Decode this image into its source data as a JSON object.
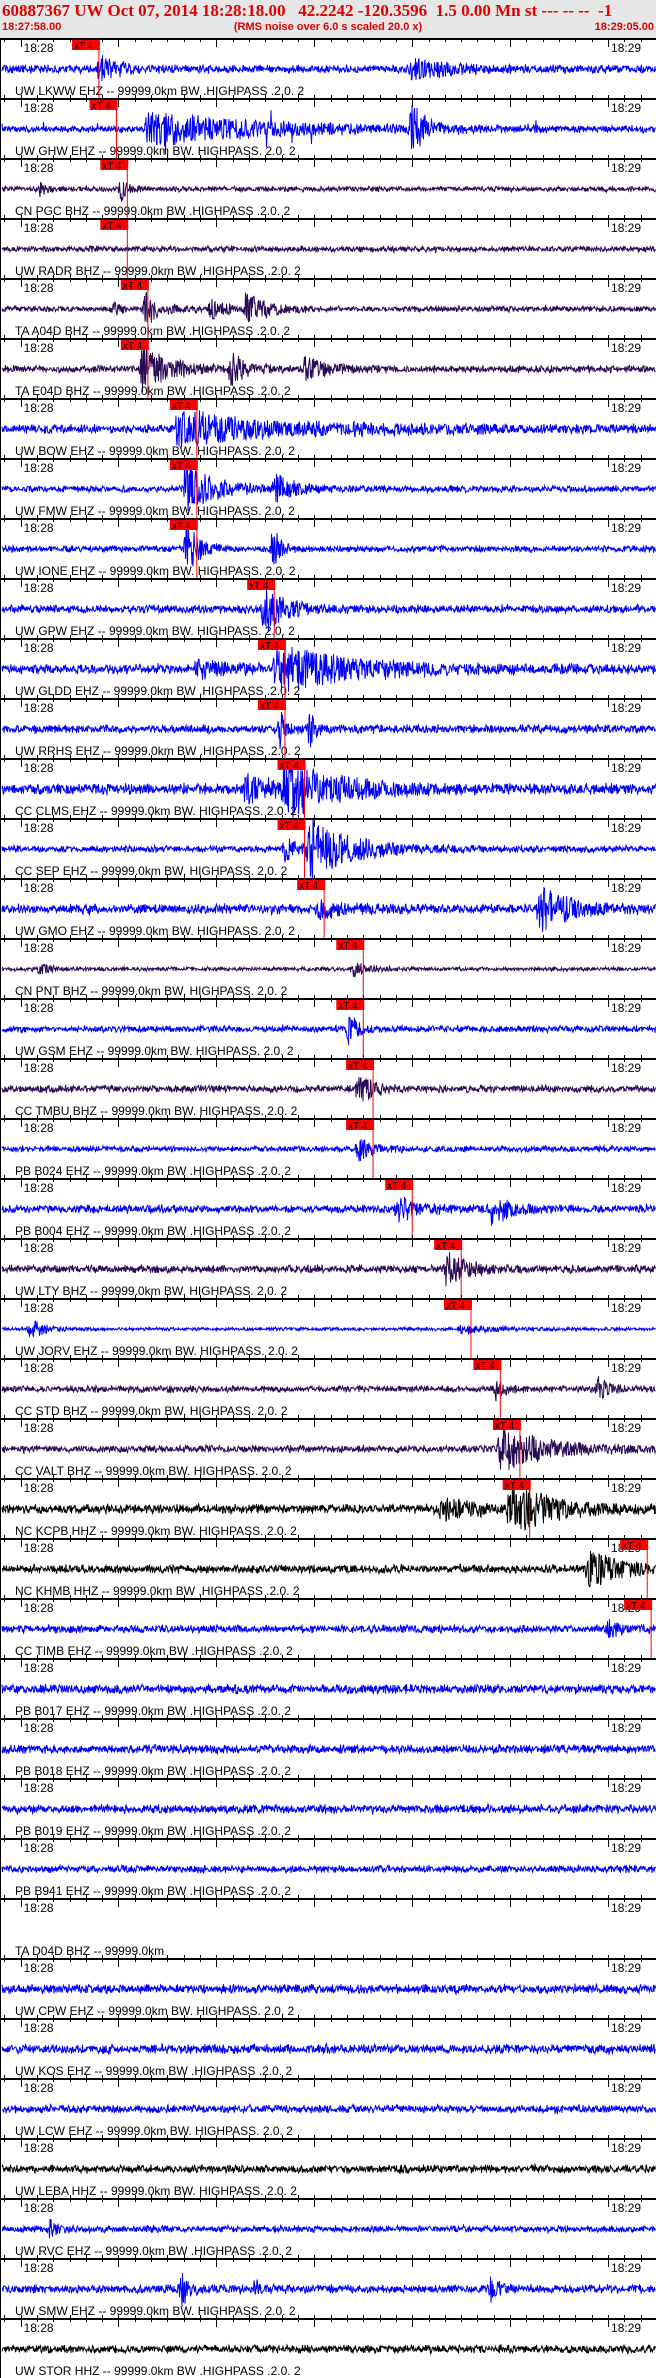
{
  "header": {
    "title": "60887367 UW Oct 07, 2014 18:28:18.00   42.2242 -120.3596  1.5 0.00 Mn st --- -- --  -1",
    "start_time": "18:27:58.00",
    "note": "(RMS noise over 6.0 s scaled 20.0 x)",
    "end_time": "18:29:05.00"
  },
  "axis": {
    "span_seconds": 67,
    "minute_labels": [
      {
        "label": "18:28",
        "t": 2
      },
      {
        "label": "18:29",
        "t": 62
      }
    ],
    "major_tick_every_s": 10,
    "minor_ticks_per_major": 6
  },
  "pick_label": "xT 4",
  "colors": {
    "blue": "#0000ff",
    "purple": "#2a0a55",
    "black": "#000000",
    "pick": "#ff0000"
  },
  "traces": [
    {
      "label": "UW LKWW EHZ -- 99999.0km BW .HIGHPASS .2.0. 2",
      "color": "blue",
      "pick": 10.0,
      "noise": 0.12,
      "bursts": [
        [
          10,
          0.45,
          4
        ],
        [
          42,
          0.35,
          8
        ]
      ]
    },
    {
      "label": "UW GHW EHZ -- 99999.0km BW. HIGHPASS. 2.0. 2",
      "color": "blue",
      "pick": 11.8,
      "noise": 0.1,
      "spiky": true,
      "bursts": [
        [
          15,
          0.6,
          22
        ],
        [
          42,
          0.9,
          3
        ]
      ]
    },
    {
      "label": "CN PGC BHZ -- 99999.0km BW .HIGHPASS .2.0. 2",
      "color": "purple",
      "pick": 12.9,
      "noise": 0.08,
      "bursts": [
        [
          4,
          0.2,
          2
        ],
        [
          12.3,
          0.4,
          1.5
        ]
      ]
    },
    {
      "label": "UW RADR BHZ -- 99999.0km BW .HIGHPASS .2.0. 2",
      "color": "purple",
      "pick": 12.9,
      "noise": 0.09,
      "bursts": []
    },
    {
      "label": "TA A04D BHZ -- 99999.0km BW .HIGHPASS .2.0. 2",
      "color": "purple",
      "pick": 15.0,
      "noise": 0.09,
      "bursts": [
        [
          11.5,
          0.2,
          1.5
        ],
        [
          14.8,
          0.55,
          3
        ],
        [
          21.5,
          0.35,
          3
        ],
        [
          25,
          0.55,
          4
        ]
      ]
    },
    {
      "label": "TA E04D BHZ -- 99999.0km BW .HIGHPASS .2.0. 2",
      "color": "purple",
      "pick": 15.0,
      "noise": 0.11,
      "bursts": [
        [
          14.5,
          0.9,
          5
        ],
        [
          23.5,
          0.55,
          3
        ],
        [
          31,
          0.4,
          4
        ]
      ]
    },
    {
      "label": "UW BOW EHZ -- 99999.0km BW. HIGHPASS. 2.0. 2",
      "color": "blue",
      "pick": 20.0,
      "noise": 0.14,
      "bursts": [
        [
          18,
          0.6,
          5
        ],
        [
          20,
          0.3,
          30
        ]
      ]
    },
    {
      "label": "UW FMW EHZ -- 99999.0km BW. HIGHPASS. 2.0. 2",
      "color": "blue",
      "pick": 20.0,
      "noise": 0.1,
      "bursts": [
        [
          18.8,
          0.85,
          6
        ],
        [
          28,
          0.45,
          4
        ]
      ]
    },
    {
      "label": "UW IONE EHZ -- 99999.0km BW. HIGHPASS. 2.0. 2",
      "color": "blue",
      "pick": 20.0,
      "noise": 0.1,
      "bursts": [
        [
          19,
          0.9,
          2.5
        ],
        [
          27.8,
          1.0,
          1.2
        ]
      ]
    },
    {
      "label": "UW GPW EHZ -- 99999.0km BW. HIGHPASS. 2.0. 2",
      "color": "blue",
      "pick": 27.9,
      "noise": 0.13,
      "bursts": [
        [
          26.8,
          0.95,
          4
        ]
      ]
    },
    {
      "label": "UW GLDD EHZ -- 99999.0km BW .HIGHPASS .2.0. 2",
      "color": "blue",
      "pick": 29.0,
      "noise": 0.15,
      "bursts": [
        [
          20,
          0.25,
          8
        ],
        [
          28,
          0.9,
          14
        ]
      ]
    },
    {
      "label": "UW RRHS EHZ -- 99999.0km BW .HIGHPASS .2.0. 2",
      "color": "blue",
      "pick": 29.0,
      "noise": 0.13,
      "bursts": [
        [
          28.6,
          0.9,
          1
        ],
        [
          31.6,
          0.7,
          1
        ]
      ]
    },
    {
      "label": "CC CLMS EHZ -- 99999.0km BW. HIGHPASS. 2.0. 2",
      "color": "blue",
      "pick": 31.0,
      "noise": 0.17,
      "bursts": [
        [
          25,
          0.5,
          6
        ],
        [
          29,
          0.95,
          10
        ]
      ]
    },
    {
      "label": "CC SEP EHZ -- 99999.0km BW. HIGHPASS. 2.0. 2",
      "color": "blue",
      "pick": 31.0,
      "noise": 0.1,
      "bursts": [
        [
          29,
          0.4,
          3
        ],
        [
          31.5,
          1.0,
          9
        ]
      ]
    },
    {
      "label": "UW GMO EHZ -- 99999.0km BW. HIGHPASS. 2.0. 2",
      "color": "blue",
      "pick": 33.0,
      "noise": 0.15,
      "bursts": [
        [
          32.5,
          0.3,
          5
        ],
        [
          55,
          0.75,
          6
        ]
      ]
    },
    {
      "label": "CN PNT BHZ -- 99999.0km BW. HIGHPASS. 2.0. 2",
      "color": "purple",
      "pick": 37.0,
      "noise": 0.06,
      "bursts": [
        [
          4,
          0.2,
          2
        ],
        [
          36,
          0.25,
          3
        ]
      ]
    },
    {
      "label": "UW GSM EHZ -- 99999.0km BW. HIGHPASS. 2.0. 2",
      "color": "blue",
      "pick": 37.0,
      "noise": 0.1,
      "bursts": [
        [
          35.5,
          0.55,
          2
        ]
      ]
    },
    {
      "label": "CC TMBU BHZ -- 99999.0km BW. HIGHPASS. 2.0. 2",
      "color": "purple",
      "pick": 38.0,
      "noise": 0.11,
      "bursts": [
        [
          36.5,
          0.5,
          3
        ]
      ]
    },
    {
      "label": "PB B024 EHZ -- 99999.0km BW .HIGHPASS .2.0. 2",
      "color": "blue",
      "pick": 38.0,
      "noise": 0.09,
      "bursts": [
        [
          36.5,
          0.35,
          3
        ]
      ]
    },
    {
      "label": "PB B004 EHZ -- 99999.0km BW .HIGHPASS .2.0. 2",
      "color": "blue",
      "pick": 42.0,
      "noise": 0.12,
      "bursts": [
        [
          40.5,
          0.45,
          4
        ],
        [
          50,
          0.55,
          4
        ]
      ]
    },
    {
      "label": "UW LTY BHZ -- 99999.0km BW. HIGHPASS. 2.0. 2",
      "color": "purple",
      "pick": 47.0,
      "noise": 0.12,
      "bursts": [
        [
          45.5,
          0.6,
          4
        ]
      ]
    },
    {
      "label": "UW JORV EHZ -- 99999.0km BW. HIGHPASS. 2.0. 2",
      "color": "blue",
      "pick": 48.0,
      "noise": 0.05,
      "bursts": [
        [
          3,
          0.35,
          3
        ],
        [
          47,
          0.18,
          5
        ]
      ]
    },
    {
      "label": "CC STD BHZ -- 99999.0km BW. HIGHPASS. 2.0. 2",
      "color": "purple",
      "pick": 51.0,
      "noise": 0.1,
      "bursts": [
        [
          50.5,
          0.35,
          2
        ],
        [
          61,
          0.4,
          2
        ]
      ]
    },
    {
      "label": "CC VALT BHZ -- 99999.0km BW. HIGHPASS. 2.0. 2",
      "color": "purple",
      "pick": 53.0,
      "noise": 0.11,
      "bursts": [
        [
          51,
          0.8,
          9
        ]
      ]
    },
    {
      "label": "NC KCPB HHZ -- 99999.0km BW. HIGHPASS. 2.0. 2",
      "color": "black",
      "pick": 54.0,
      "noise": 0.14,
      "bursts": [
        [
          45,
          0.4,
          6
        ],
        [
          52,
          0.95,
          8
        ]
      ]
    },
    {
      "label": "NC KHMB HHZ -- 99999.0km BW .HIGHPASS .2.0. 2",
      "color": "black",
      "pick": 66.0,
      "noise": 0.13,
      "bursts": [
        [
          60,
          0.65,
          6
        ]
      ]
    },
    {
      "label": "CC TIMB EHZ -- 99999.0km BW .HIGHPASS .2.0. 2",
      "color": "blue",
      "pick": 66.4,
      "noise": 0.12,
      "bursts": [
        [
          62,
          0.3,
          3
        ]
      ]
    },
    {
      "label": "PB B017 EHZ -- 99999.0km BW .HIGHPASS .2.0. 2",
      "color": "blue",
      "noise": 0.14,
      "bursts": []
    },
    {
      "label": "PB B018 EHZ -- 99999.0km BW .HIGHPASS .2.0. 2",
      "color": "blue",
      "noise": 0.13,
      "bursts": []
    },
    {
      "label": "PB B019 EHZ -- 99999.0km BW .HIGHPASS .2.0. 2",
      "color": "blue",
      "noise": 0.13,
      "bursts": []
    },
    {
      "label": "PB B941 EHZ -- 99999.0km BW .HIGHPASS .2.0. 2",
      "color": "blue",
      "noise": 0.11,
      "bursts": []
    },
    {
      "label": "TA D04D BHZ -- 99999.0km",
      "color": "blue",
      "empty": true,
      "noise": 0,
      "bursts": []
    },
    {
      "label": "UW CPW EHZ -- 99999.0km BW. HIGHPASS. 2.0. 2",
      "color": "blue",
      "noise": 0.14,
      "bursts": []
    },
    {
      "label": "UW KOS EHZ -- 99999.0km BW .HIGHPASS .2.0. 2",
      "color": "blue",
      "noise": 0.14,
      "bursts": []
    },
    {
      "label": "UW LCW EHZ -- 99999.0km BW. HIGHPASS. 2.0. 2",
      "color": "blue",
      "noise": 0.12,
      "bursts": []
    },
    {
      "label": "UW LEBA HHZ -- 99999.0km BW. HIGHPASS. 2.0. 2",
      "color": "black",
      "noise": 0.12,
      "bursts": []
    },
    {
      "label": "UW RVC EHZ -- 99999.0km BW .HIGHPASS .2.0. 2",
      "color": "blue",
      "noise": 0.1,
      "bursts": [
        [
          5,
          0.25,
          2
        ]
      ]
    },
    {
      "label": "UW SMW EHZ -- 99999.0km BW. HIGHPASS. 2.0. 2",
      "color": "blue",
      "noise": 0.13,
      "bursts": [
        [
          18.5,
          0.55,
          2
        ],
        [
          26,
          0.3,
          2
        ],
        [
          50,
          0.45,
          2
        ]
      ]
    },
    {
      "label": "UW STOR HHZ -- 99999.0km BW .HIGHPASS .2.0. 2",
      "color": "black",
      "noise": 0.12,
      "bursts": []
    }
  ]
}
